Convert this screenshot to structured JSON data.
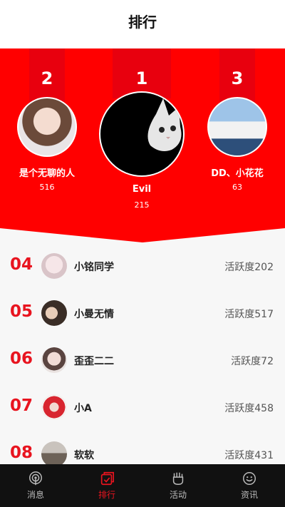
{
  "header": {
    "title": "排行"
  },
  "podium": [
    {
      "rank": "2",
      "name": "是个无聊的人",
      "score": "516"
    },
    {
      "rank": "1",
      "name": "Evil",
      "score": "215"
    },
    {
      "rank": "3",
      "name": "DD、小花花",
      "score": "63"
    }
  ],
  "list": [
    {
      "rank": "04",
      "name": "小铭同学",
      "activity": "活跃度202"
    },
    {
      "rank": "05",
      "name": "小曼无情",
      "activity": "活跃度517"
    },
    {
      "rank": "06",
      "name": "歪歪二二",
      "activity": "活跃度72"
    },
    {
      "rank": "07",
      "name": "小A",
      "activity": "活跃度458"
    },
    {
      "rank": "08",
      "name": "软软",
      "activity": "活跃度431"
    }
  ],
  "tabs": [
    {
      "label": "消息",
      "icon": "broadcast-icon",
      "active": false
    },
    {
      "label": "排行",
      "icon": "ranking-icon",
      "active": true
    },
    {
      "label": "活动",
      "icon": "hand-icon",
      "active": false
    },
    {
      "label": "资讯",
      "icon": "smile-icon",
      "active": false
    }
  ],
  "colors": {
    "brand_red": "#ff0000",
    "accent_red": "#e8141f",
    "tabbar_bg": "#111111"
  }
}
